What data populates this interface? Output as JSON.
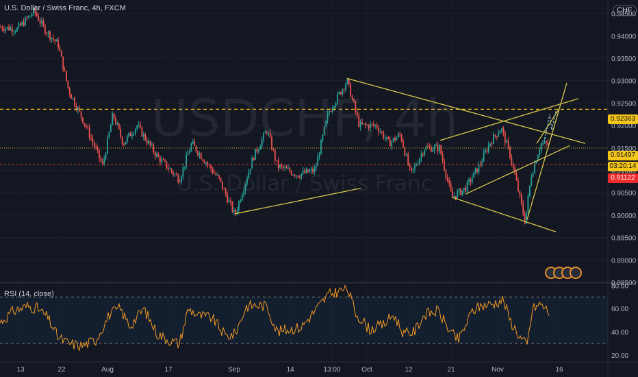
{
  "header": {
    "title": "U.S. Dollar / Swiss Franc, 4h, FXCM",
    "currency": "CHF"
  },
  "watermark": {
    "symbol": "USDCHF, 4h",
    "description": "U.S. Dollar / Swiss Franc"
  },
  "price_tags": {
    "resistance": "0.92363",
    "last_price": "0.91497",
    "countdown": "03:20:14",
    "bid": "0.91122"
  },
  "indicator": {
    "title": "RSI (14, close)"
  },
  "colors": {
    "background": "#131722",
    "up_candle": "#26a69a",
    "down_candle": "#ef5350",
    "trendline": "#d9c94a",
    "rsi_line": "#f59b22",
    "resistance_line": "#f5c518"
  },
  "chart_data": [
    {
      "type": "candlestick",
      "symbol": "USDCHF",
      "timeframe": "4h",
      "x_ticks": [
        "13",
        "22",
        "Aug",
        "17",
        "Sep",
        "14",
        "13:00",
        "Oct",
        "12",
        "21",
        "Nov",
        "16"
      ],
      "y_ticks": [
        "0.94500",
        "0.94000",
        "0.93500",
        "0.93000",
        "0.92500",
        "0.92000",
        "0.91500",
        "0.91000",
        "0.90500",
        "0.90000",
        "0.89500",
        "0.89000",
        "0.88500"
      ],
      "ylim": [
        0.885,
        0.948
      ],
      "close_path": [
        [
          0,
          0.942
        ],
        [
          25,
          0.9415
        ],
        [
          50,
          0.9455
        ],
        [
          65,
          0.9415
        ],
        [
          85,
          0.938
        ],
        [
          100,
          0.928
        ],
        [
          125,
          0.92
        ],
        [
          150,
          0.911
        ],
        [
          165,
          0.9225
        ],
        [
          180,
          0.916
        ],
        [
          200,
          0.92
        ],
        [
          230,
          0.913
        ],
        [
          262,
          0.908
        ],
        [
          280,
          0.916
        ],
        [
          305,
          0.911
        ],
        [
          320,
          0.908
        ],
        [
          343,
          0.9
        ],
        [
          370,
          0.913
        ],
        [
          390,
          0.919
        ],
        [
          405,
          0.911
        ],
        [
          435,
          0.909
        ],
        [
          460,
          0.91
        ],
        [
          480,
          0.923
        ],
        [
          507,
          0.93
        ],
        [
          525,
          0.92
        ],
        [
          550,
          0.92
        ],
        [
          568,
          0.916
        ],
        [
          585,
          0.918
        ],
        [
          600,
          0.909
        ],
        [
          620,
          0.915
        ],
        [
          642,
          0.915
        ],
        [
          660,
          0.904
        ],
        [
          680,
          0.906
        ],
        [
          700,
          0.911
        ],
        [
          715,
          0.916
        ],
        [
          732,
          0.9195
        ],
        [
          745,
          0.9135
        ],
        [
          755,
          0.907
        ],
        [
          767,
          0.8985
        ],
        [
          776,
          0.909
        ],
        [
          790,
          0.916
        ],
        [
          802,
          0.9158
        ]
      ],
      "annotations": {
        "horizontal_levels": [
          0.92363,
          0.91497,
          0.91122
        ],
        "trendlines": [
          {
            "from": [
              343,
              0.9003
            ],
            "to": [
              527,
              0.906
            ]
          },
          {
            "from": [
              507,
              0.9305
            ],
            "to": [
              855,
              0.916
            ]
          },
          {
            "from": [
              660,
              0.904
            ],
            "to": [
              812,
              0.8963
            ]
          },
          {
            "from": [
              643,
              0.9167
            ],
            "to": [
              845,
              0.926
            ]
          },
          {
            "from": [
              680,
              0.9047
            ],
            "to": [
              832,
              0.9155
            ]
          },
          {
            "from": [
              770,
              0.899
            ],
            "to": [
              828,
              0.9295
            ]
          },
          {
            "from": [
              784,
              0.916
            ],
            "to": [
              818,
              0.924
            ]
          }
        ]
      }
    },
    {
      "type": "line",
      "name": "RSI (14, close)",
      "y_ticks": [
        "80.00",
        "60.00",
        "40.00",
        "20.00"
      ],
      "ylim": [
        14,
        82
      ],
      "bands": [
        70,
        30
      ],
      "rsi_path": [
        [
          0,
          48
        ],
        [
          20,
          58
        ],
        [
          40,
          62
        ],
        [
          55,
          60
        ],
        [
          70,
          52
        ],
        [
          85,
          35
        ],
        [
          100,
          30
        ],
        [
          120,
          28
        ],
        [
          140,
          33
        ],
        [
          160,
          55
        ],
        [
          175,
          60
        ],
        [
          190,
          45
        ],
        [
          210,
          60
        ],
        [
          230,
          38
        ],
        [
          250,
          32
        ],
        [
          262,
          30
        ],
        [
          275,
          60
        ],
        [
          290,
          54
        ],
        [
          310,
          52
        ],
        [
          330,
          36
        ],
        [
          343,
          38
        ],
        [
          360,
          62
        ],
        [
          375,
          63
        ],
        [
          390,
          62
        ],
        [
          405,
          40
        ],
        [
          420,
          42
        ],
        [
          440,
          44
        ],
        [
          460,
          58
        ],
        [
          480,
          72
        ],
        [
          495,
          75
        ],
        [
          507,
          78
        ],
        [
          520,
          56
        ],
        [
          540,
          42
        ],
        [
          560,
          46
        ],
        [
          575,
          55
        ],
        [
          590,
          38
        ],
        [
          605,
          40
        ],
        [
          620,
          55
        ],
        [
          640,
          58
        ],
        [
          660,
          38
        ],
        [
          670,
          33
        ],
        [
          690,
          58
        ],
        [
          705,
          63
        ],
        [
          720,
          64
        ],
        [
          735,
          68
        ],
        [
          745,
          50
        ],
        [
          760,
          35
        ],
        [
          770,
          28
        ],
        [
          778,
          60
        ],
        [
          790,
          64
        ],
        [
          802,
          57
        ]
      ]
    }
  ]
}
